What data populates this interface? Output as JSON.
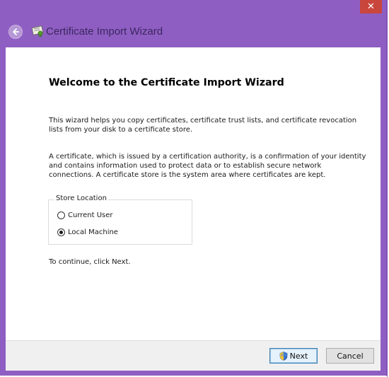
{
  "window": {
    "title": "Certificate Import Wizard",
    "close_glyph": "✕",
    "accent_color": "#8f5ec2",
    "close_color": "#c9463d"
  },
  "icons": {
    "back": "back-arrow-icon",
    "title": "certificate-icon",
    "next_button": "uac-shield-icon"
  },
  "main": {
    "heading": "Welcome to the Certificate Import Wizard",
    "paragraph1": "This wizard helps you copy certificates, certificate trust lists, and certificate revocation lists from your disk to a certificate store.",
    "paragraph2": "A certificate, which is issued by a certification authority, is a confirmation of your identity and contains information used to protect data or to establish secure network connections. A certificate store is the system area where certificates are kept.",
    "store_location": {
      "legend": "Store Location",
      "options": [
        {
          "label": "Current User",
          "selected": false
        },
        {
          "label": "Local Machine",
          "selected": true
        }
      ]
    },
    "continue_text": "To continue, click Next."
  },
  "footer": {
    "next_label": "Next",
    "cancel_label": "Cancel"
  }
}
